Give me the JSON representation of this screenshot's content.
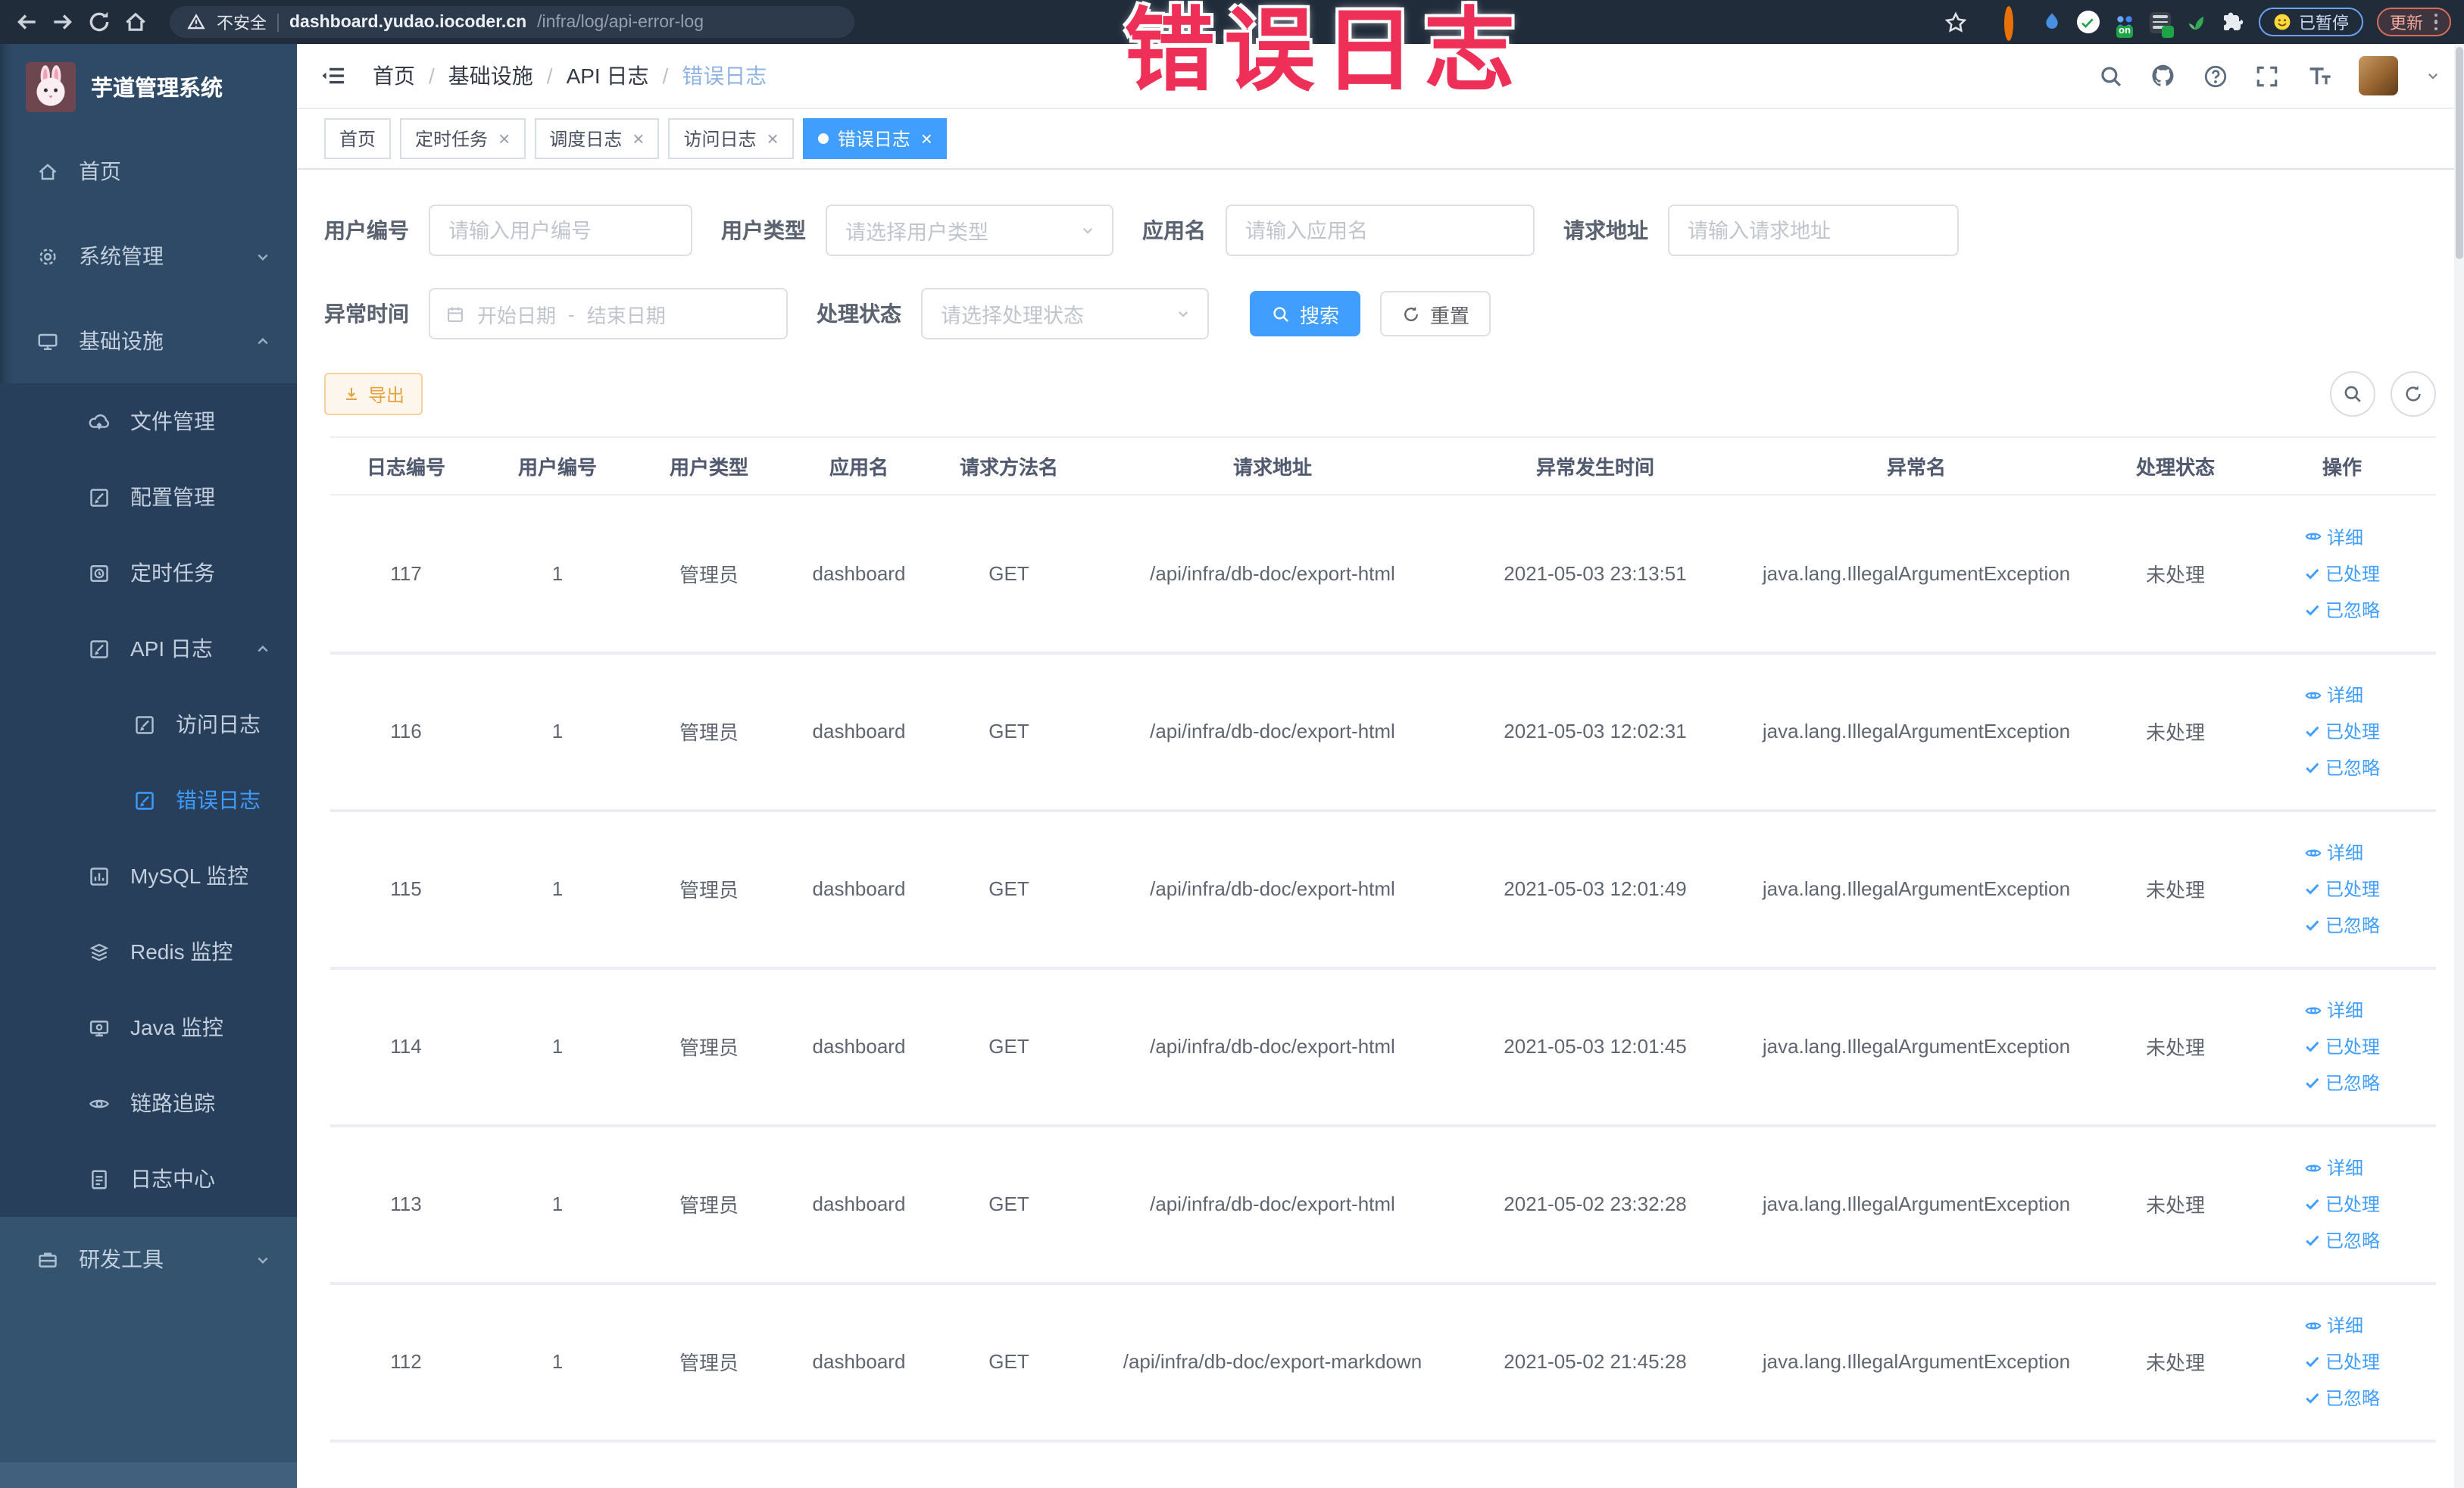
{
  "annotation": {
    "text": "错误日志",
    "color": "#ee2f57"
  },
  "browser": {
    "security_label": "不安全",
    "url_host": "dashboard.yudao.iocoder.cn",
    "url_path": "/infra/log/api-error-log",
    "extension_badge": "on",
    "paused_badge": "已暂停",
    "update_button": "更新"
  },
  "sidebar": {
    "logo_title": "芋道管理系统",
    "items": [
      {
        "label": "首页"
      },
      {
        "label": "系统管理"
      },
      {
        "label": "基础设施"
      },
      {
        "label": "文件管理"
      },
      {
        "label": "配置管理"
      },
      {
        "label": "定时任务"
      },
      {
        "label": "API 日志"
      },
      {
        "label": "访问日志"
      },
      {
        "label": "错误日志"
      },
      {
        "label": "MySQL 监控"
      },
      {
        "label": "Redis 监控"
      },
      {
        "label": "Java 监控"
      },
      {
        "label": "链路追踪"
      },
      {
        "label": "日志中心"
      },
      {
        "label": "研发工具"
      }
    ]
  },
  "navbar": {
    "breadcrumb": [
      "首页",
      "基础设施",
      "API 日志",
      "错误日志"
    ],
    "separator": "/"
  },
  "tabs": [
    {
      "label": "首页"
    },
    {
      "label": "定时任务"
    },
    {
      "label": "调度日志"
    },
    {
      "label": "访问日志"
    },
    {
      "label": "错误日志"
    }
  ],
  "filters": {
    "user_id": {
      "label": "用户编号",
      "placeholder": "请输入用户编号"
    },
    "user_type": {
      "label": "用户类型",
      "placeholder": "请选择用户类型"
    },
    "app_name": {
      "label": "应用名",
      "placeholder": "请输入应用名"
    },
    "request_url": {
      "label": "请求地址",
      "placeholder": "请输入请求地址"
    },
    "exception_time": {
      "label": "异常时间",
      "start_placeholder": "开始日期",
      "separator": "-",
      "end_placeholder": "结束日期"
    },
    "process_status": {
      "label": "处理状态",
      "placeholder": "请选择处理状态"
    },
    "search_button": "搜索",
    "reset_button": "重置"
  },
  "toolbar": {
    "export_button": "导出"
  },
  "table": {
    "columns": [
      "日志编号",
      "用户编号",
      "用户类型",
      "应用名",
      "请求方法名",
      "请求地址",
      "异常发生时间",
      "异常名",
      "处理状态",
      "操作"
    ],
    "actions": {
      "detail": "详细",
      "processed": "已处理",
      "ignored": "已忽略"
    },
    "rows": [
      {
        "id": "117",
        "user_id": "1",
        "user_type": "管理员",
        "app_name": "dashboard",
        "method": "GET",
        "url": "/api/infra/db-doc/export-html",
        "time": "2021-05-03 23:13:51",
        "exception": "java.lang.IllegalArgumentException",
        "status": "未处理"
      },
      {
        "id": "116",
        "user_id": "1",
        "user_type": "管理员",
        "app_name": "dashboard",
        "method": "GET",
        "url": "/api/infra/db-doc/export-html",
        "time": "2021-05-03 12:02:31",
        "exception": "java.lang.IllegalArgumentException",
        "status": "未处理"
      },
      {
        "id": "115",
        "user_id": "1",
        "user_type": "管理员",
        "app_name": "dashboard",
        "method": "GET",
        "url": "/api/infra/db-doc/export-html",
        "time": "2021-05-03 12:01:49",
        "exception": "java.lang.IllegalArgumentException",
        "status": "未处理"
      },
      {
        "id": "114",
        "user_id": "1",
        "user_type": "管理员",
        "app_name": "dashboard",
        "method": "GET",
        "url": "/api/infra/db-doc/export-html",
        "time": "2021-05-03 12:01:45",
        "exception": "java.lang.IllegalArgumentException",
        "status": "未处理"
      },
      {
        "id": "113",
        "user_id": "1",
        "user_type": "管理员",
        "app_name": "dashboard",
        "method": "GET",
        "url": "/api/infra/db-doc/export-html",
        "time": "2021-05-02 23:32:28",
        "exception": "java.lang.IllegalArgumentException",
        "status": "未处理"
      },
      {
        "id": "112",
        "user_id": "1",
        "user_type": "管理员",
        "app_name": "dashboard",
        "method": "GET",
        "url": "/api/infra/db-doc/export-markdown",
        "time": "2021-05-02 21:45:28",
        "exception": "java.lang.IllegalArgumentException",
        "status": "未处理"
      }
    ]
  },
  "colors": {
    "primary": "#409eff",
    "warning": "#e6a23c",
    "sidebar_bg": "#2e4a66",
    "annotation_pink": "#ee2f57"
  }
}
